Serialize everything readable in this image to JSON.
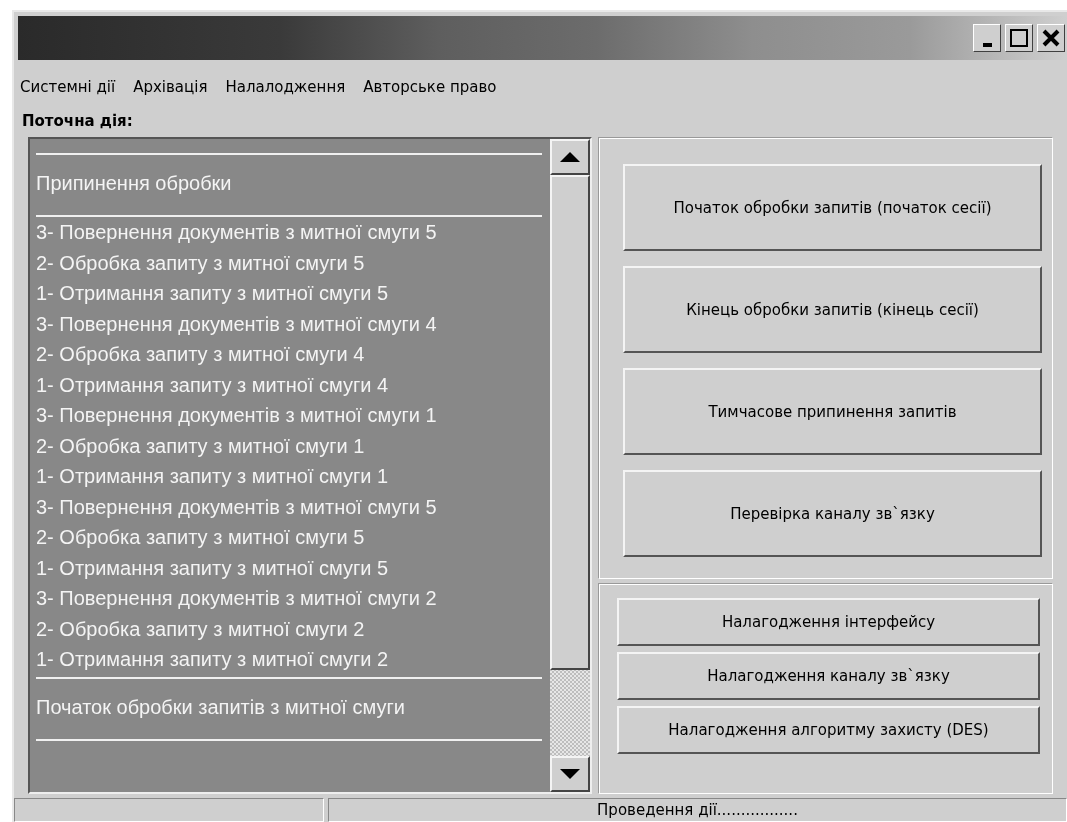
{
  "menu": [
    "Системні дії",
    "Архівація",
    "Налалодження",
    "Авторське право"
  ],
  "current_action_label": "Поточна дія:",
  "log": [
    {
      "kind": "rule"
    },
    {
      "kind": "header",
      "text": "Припинення обробки"
    },
    {
      "kind": "rule"
    },
    {
      "kind": "item",
      "text": "3- Повернення документів з митної смуги 5"
    },
    {
      "kind": "item",
      "text": "2- Обробка запиту з митної смуги 5"
    },
    {
      "kind": "item",
      "text": "1- Отримання запиту з митної смуги 5"
    },
    {
      "kind": "item",
      "text": "3- Повернення документів з митної смуги 4"
    },
    {
      "kind": "item",
      "text": "2- Обробка запиту з митної смуги 4"
    },
    {
      "kind": "item",
      "text": "1- Отримання запиту з митної смуги 4"
    },
    {
      "kind": "item",
      "text": "3- Повернення документів з митної смуги 1"
    },
    {
      "kind": "item",
      "text": "2- Обробка запиту з митної смуги 1"
    },
    {
      "kind": "item",
      "text": "1- Отримання запиту з митної смуги 1"
    },
    {
      "kind": "item",
      "text": "3- Повернення документів з митної смуги 5"
    },
    {
      "kind": "item",
      "text": "2- Обробка запиту з митної смуги 5"
    },
    {
      "kind": "item",
      "text": "1- Отримання запиту з митної смуги 5"
    },
    {
      "kind": "item",
      "text": "3- Повернення документів з митної смуги 2"
    },
    {
      "kind": "item",
      "text": "2- Обробка запиту з митної смуги 2"
    },
    {
      "kind": "item",
      "text": "1- Отримання запиту з митної смуги 2"
    },
    {
      "kind": "rule"
    },
    {
      "kind": "header",
      "text": "Початок обробки запитів з митної смуги"
    },
    {
      "kind": "rule"
    }
  ],
  "session_buttons": [
    "Початок обробки запитів (початок сесії)",
    "Кінець обробки запитів (кінець сесії)",
    "Тимчасове припинення запитів",
    "Перевірка каналу зв`язку"
  ],
  "setup_buttons": [
    "Налагодження інтерфейсу",
    "Налагодження  каналу зв`язку",
    "Налагодження алгоритму захисту (DES)"
  ],
  "status_bar": {
    "panel_2": "Проведення дії................."
  }
}
